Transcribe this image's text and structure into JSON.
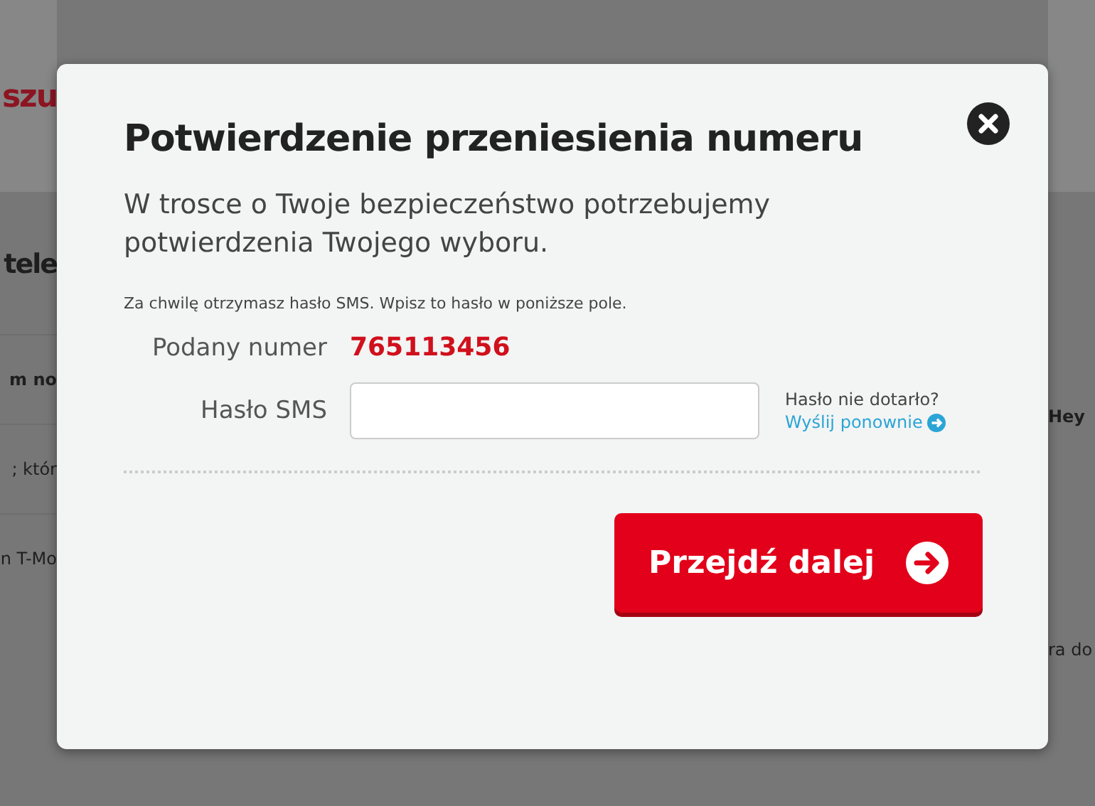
{
  "background": {
    "logo_fragment": "szu",
    "heading_fragment": "tele",
    "left_rows": [
      "m no",
      "; któr",
      "n T-Mo"
    ],
    "right_rows": [
      "Hey",
      "ra do"
    ]
  },
  "dialog": {
    "title": "Potwierdzenie przeniesienia numeru",
    "subtitle": "W trosce o Twoje bezpieczeństwo potrzebujemy potwierdzenia Twojego wyboru.",
    "info": "Za chwilę otrzymasz hasło SMS. Wpisz to hasło w poniższe pole.",
    "number_label": "Podany numer",
    "number_value": "765113456",
    "sms_label": "Hasło SMS",
    "resend_question": "Hasło nie dotarło?",
    "resend_link": "Wyślij ponownie",
    "submit": "Przejdź dalej"
  }
}
